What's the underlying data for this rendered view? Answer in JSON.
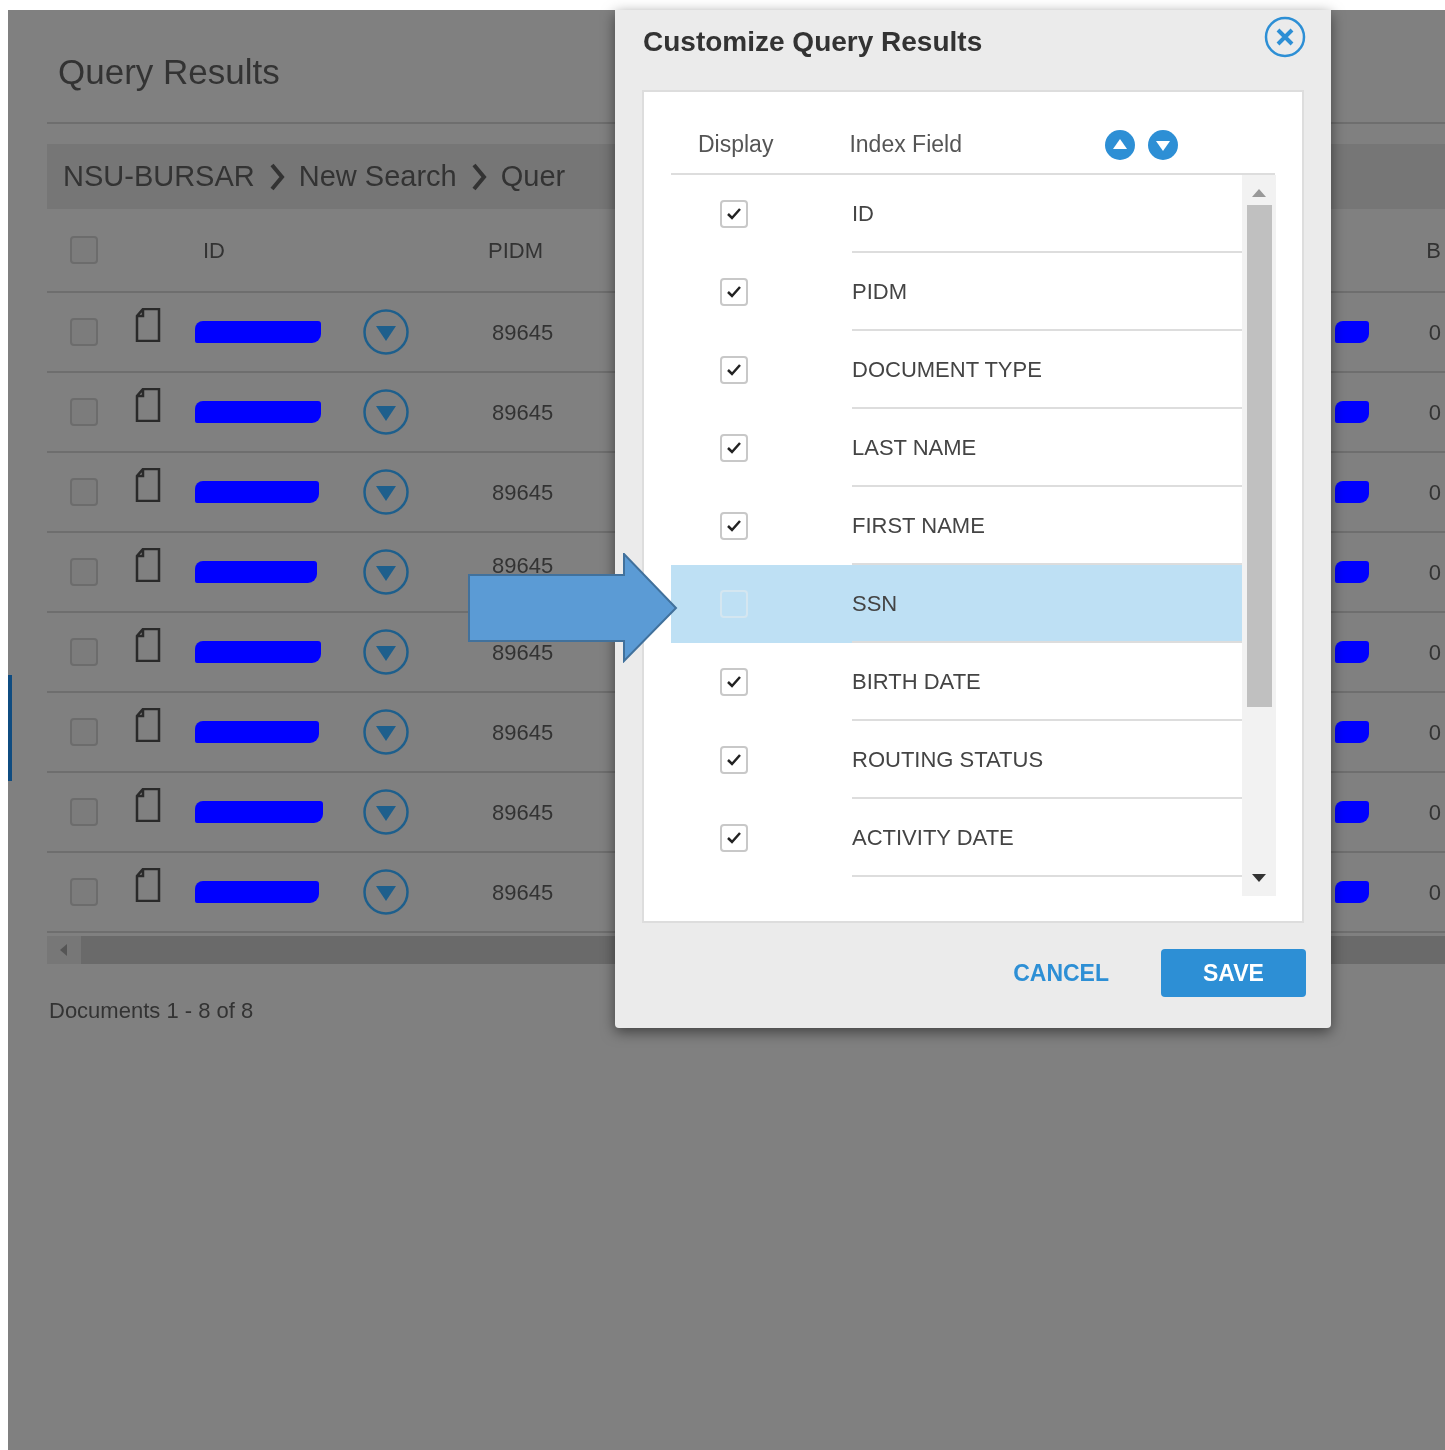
{
  "page": {
    "title": "Query Results",
    "breadcrumb": [
      "NSU-BURSAR",
      "New Search",
      "Quer"
    ],
    "table": {
      "select_all_checked": false,
      "columns": [
        "ID",
        "PIDM"
      ],
      "edge_column": "B",
      "rows": [
        {
          "checked": false,
          "pidm": "89645",
          "edge": "0"
        },
        {
          "checked": false,
          "pidm": "89645",
          "edge": "0"
        },
        {
          "checked": false,
          "pidm": "89645",
          "edge": "0"
        },
        {
          "checked": false,
          "pidm": "89645",
          "edge": "0"
        },
        {
          "checked": false,
          "pidm": "89645",
          "edge": "0"
        },
        {
          "checked": false,
          "pidm": "89645",
          "edge": "0"
        },
        {
          "checked": false,
          "pidm": "89645",
          "edge": "0"
        },
        {
          "checked": false,
          "pidm": "89645",
          "edge": "0"
        }
      ]
    },
    "footer": "Documents 1 - 8 of 8"
  },
  "dialog": {
    "title": "Customize Query Results",
    "columns": [
      "Display",
      "Index Field"
    ],
    "fields": [
      {
        "label": "ID",
        "checked": true,
        "selected": false
      },
      {
        "label": "PIDM",
        "checked": true,
        "selected": false
      },
      {
        "label": "DOCUMENT TYPE",
        "checked": true,
        "selected": false
      },
      {
        "label": "LAST NAME",
        "checked": true,
        "selected": false
      },
      {
        "label": "FIRST NAME",
        "checked": true,
        "selected": false
      },
      {
        "label": "SSN",
        "checked": false,
        "selected": true
      },
      {
        "label": "BIRTH DATE",
        "checked": true,
        "selected": false
      },
      {
        "label": "ROUTING STATUS",
        "checked": true,
        "selected": false
      },
      {
        "label": "ACTIVITY DATE",
        "checked": true,
        "selected": false
      }
    ],
    "buttons": [
      {
        "kind": "link",
        "label": "CANCEL"
      },
      {
        "kind": "primary",
        "label": "SAVE"
      }
    ]
  }
}
